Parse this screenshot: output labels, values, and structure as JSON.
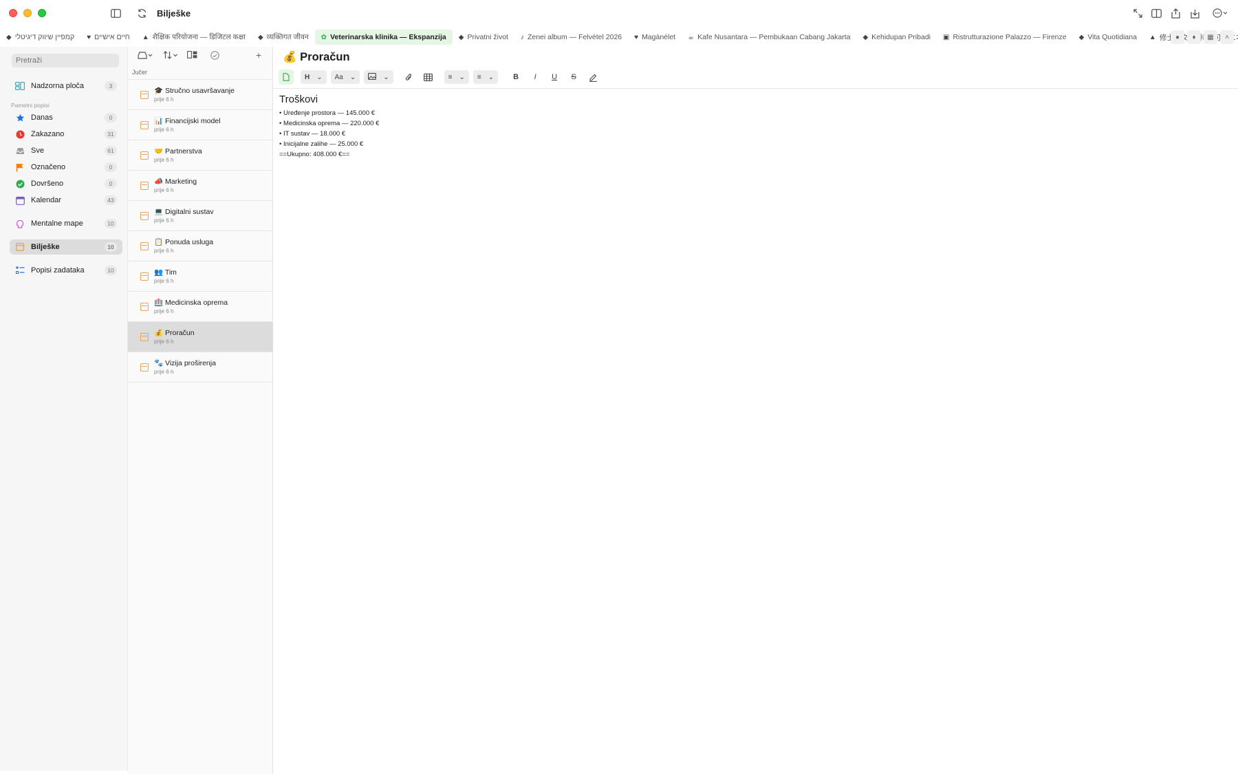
{
  "app": {
    "title": "Bilješke"
  },
  "tabs": [
    {
      "label": "קמפיין שיווק דיגיטלי",
      "icon": "tag-icon",
      "active": false
    },
    {
      "label": "חיים אישיים",
      "icon": "heart-icon",
      "active": false
    },
    {
      "label": "शैक्षिक परियोजना — डिजिटल कक्षा",
      "icon": "graduation-cap-icon",
      "active": false
    },
    {
      "label": "व्यक्तिगत जीवन",
      "icon": "tag-icon",
      "active": false
    },
    {
      "label": "Veterinarska klinika — Ekspanzija",
      "icon": "paw-icon",
      "active": true
    },
    {
      "label": "Privatni život",
      "icon": "tag-icon",
      "active": false
    },
    {
      "label": "Zenei album — Felvétel 2026",
      "icon": "music-note-icon",
      "active": false
    },
    {
      "label": "Magánélet",
      "icon": "heart-icon",
      "active": false
    },
    {
      "label": "Kafe Nusantara — Pembukaan Cabang Jakarta",
      "icon": "coffee-icon",
      "active": false
    },
    {
      "label": "Kehidupan Pribadi",
      "icon": "tag-icon",
      "active": false
    },
    {
      "label": "Ristrutturazione Palazzo — Firenze",
      "icon": "building-icon",
      "active": false
    },
    {
      "label": "Vita Quotidiana",
      "icon": "tag-icon",
      "active": false
    },
    {
      "label": "修士論文 — 持続可能エネルギー",
      "icon": "graduation-cap-icon",
      "active": false
    }
  ],
  "sidebar": {
    "search_placeholder": "Pretraži",
    "dashboard": {
      "label": "Nadzorna ploča",
      "count": "3"
    },
    "smart_lists_label": "Pametni popisi",
    "smart_lists": [
      {
        "label": "Danas",
        "count": "0",
        "icon": "star-icon",
        "color": "#1a73e8"
      },
      {
        "label": "Zakazano",
        "count": "31",
        "icon": "clock-icon",
        "color": "#e53935"
      },
      {
        "label": "Sve",
        "count": "61",
        "icon": "tray-icon",
        "color": "#8e8e93"
      },
      {
        "label": "Označeno",
        "count": "0",
        "icon": "flag-icon",
        "color": "#f57c00"
      },
      {
        "label": "Dovršeno",
        "count": "0",
        "icon": "check-circle-icon",
        "color": "#34a853"
      },
      {
        "label": "Kalendar",
        "count": "43",
        "icon": "calendar-icon",
        "color": "#7e57c2"
      }
    ],
    "mind_maps": {
      "label": "Mentalne mape",
      "count": "10"
    },
    "notes": {
      "label": "Bilješke",
      "count": "10"
    },
    "task_lists": {
      "label": "Popisi zadataka",
      "count": "10"
    }
  },
  "list": {
    "group_label": "Jučer",
    "notes": [
      {
        "emoji": "🎓",
        "title": "Stručno usavršavanje",
        "time": "prije 6 h"
      },
      {
        "emoji": "📊",
        "title": "Financijski model",
        "time": "prije 6 h"
      },
      {
        "emoji": "🤝",
        "title": "Partnerstva",
        "time": "prije 6 h"
      },
      {
        "emoji": "📣",
        "title": "Marketing",
        "time": "prije 6 h"
      },
      {
        "emoji": "💻",
        "title": "Digitalni sustav",
        "time": "prije 6 h"
      },
      {
        "emoji": "📋",
        "title": "Ponuda usluga",
        "time": "prije 6 h"
      },
      {
        "emoji": "👥",
        "title": "Tim",
        "time": "prije 6 h"
      },
      {
        "emoji": "🏥",
        "title": "Medicinska oprema",
        "time": "prije 6 h"
      },
      {
        "emoji": "💰",
        "title": "Proračun",
        "time": "prije 6 h",
        "selected": true
      },
      {
        "emoji": "🐾",
        "title": "Vizija proširenja",
        "time": "prije 6 h"
      }
    ]
  },
  "editor": {
    "title_emoji": "💰",
    "title": "Proračun",
    "toolbar": {
      "heading_label": "H",
      "font_label": "Aa",
      "bold": "B",
      "italic": "I",
      "underline": "U",
      "strike": "S"
    },
    "heading": "Troškovi",
    "lines": [
      "• Uređenje prostora — 145.000 €",
      "• Medicinska oprema — 220.000 €",
      "• IT sustav — 18.000 €",
      "• Inicijalne zalihe — 25.000 €",
      "==Ukupno: 408.000 €=="
    ]
  }
}
